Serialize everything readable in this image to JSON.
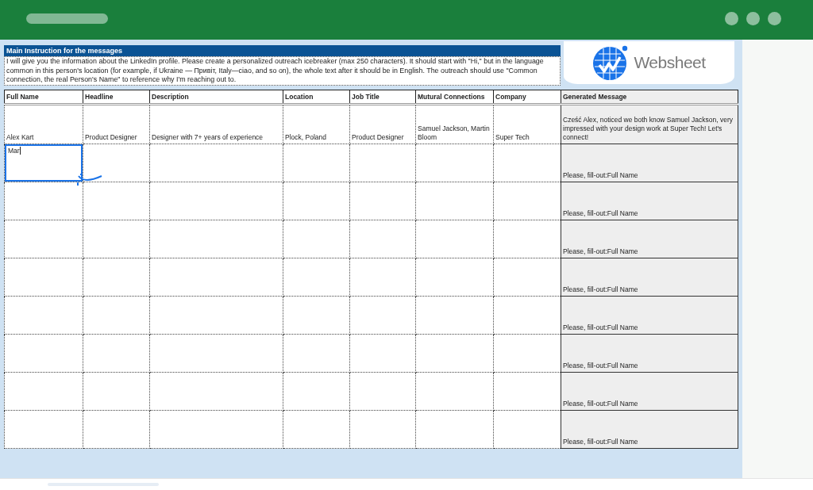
{
  "instruction": {
    "title": "Main Instruction for the messages",
    "text": "I will give you the information about the LinkedIn profile. Please create a personalized outreach icebreaker (max 250 characters). It should start with \"Hi,\" but in the language common in this person's location (for example, if Ukraine — Привіт, Italy—ciao, and so on), the whole text after it should be in English. The outreach should use \"Common connection, the real Person's Name\" to reference why I'm reaching out to."
  },
  "logo": {
    "text": "Websheet"
  },
  "columns": [
    {
      "label": "Full Name"
    },
    {
      "label": "Headline"
    },
    {
      "label": "Description"
    },
    {
      "label": "Location"
    },
    {
      "label": "Job Title"
    },
    {
      "label": "Mutural Connections"
    },
    {
      "label": "Company"
    },
    {
      "label": "Generated Message"
    }
  ],
  "rows": [
    {
      "editing": false,
      "full_name": "Alex Kart",
      "headline": "Product Designer",
      "description": "Designer with 7+ years of experience",
      "location": "Plock, Poland",
      "job_title": "Product Designer",
      "mutual_connections": "Samuel Jackson, Martin Bloom",
      "company": "Super Tech",
      "generated_message": "Cześć Alex, noticed we both know Samuel Jackson, very impressed with your design work at Super Tech! Let's connect!"
    },
    {
      "editing": true,
      "full_name": "Mar",
      "generated_message": "Please, fill-out:Full Name"
    },
    {
      "editing": false,
      "generated_message": "Please, fill-out:Full Name"
    },
    {
      "editing": false,
      "generated_message": "Please, fill-out:Full Name"
    },
    {
      "editing": false,
      "generated_message": "Please, fill-out:Full Name"
    },
    {
      "editing": false,
      "generated_message": "Please, fill-out:Full Name"
    },
    {
      "editing": false,
      "generated_message": "Please, fill-out:Full Name"
    },
    {
      "editing": false,
      "generated_message": "Please, fill-out:Full Name"
    },
    {
      "editing": false,
      "generated_message": "Please, fill-out:Full Name"
    }
  ]
}
